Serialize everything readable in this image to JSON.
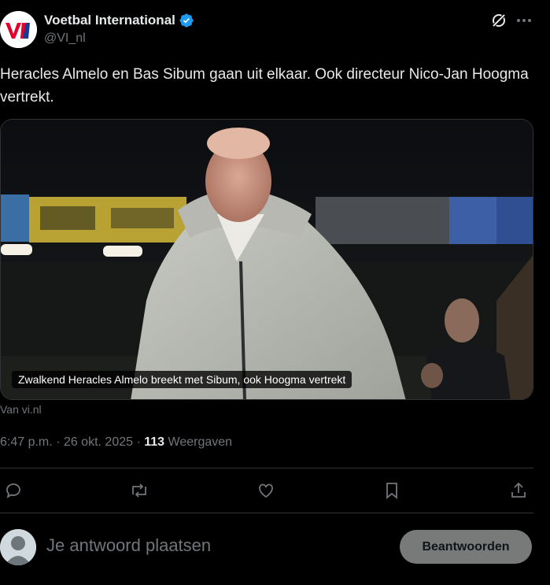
{
  "author": {
    "name": "Voetbal International",
    "handle": "@VI_nl",
    "verified": true,
    "logo_text": "VI",
    "brand_color": "#e4002b"
  },
  "tweet": {
    "text": "Heracles Almelo en Bas Sibum gaan uit elkaar. Ook directeur Nico-Jan Hoogma vertrekt."
  },
  "media": {
    "caption": "Zwalkend Heracles Almelo breekt met Sibum, ook Hoogma vertrekt",
    "source": "Van vi.nl"
  },
  "meta": {
    "time": "6:47 p.m.",
    "separator": "·",
    "date": "26 okt. 2025",
    "separator2": "·",
    "views_count": "113",
    "views_label": "Weergaven"
  },
  "actions": [
    {
      "icon": "reply-icon"
    },
    {
      "icon": "retweet-icon"
    },
    {
      "icon": "like-icon"
    },
    {
      "icon": "bookmark-icon"
    },
    {
      "icon": "share-icon"
    }
  ],
  "reply": {
    "placeholder": "Je antwoord plaatsen",
    "button_label": "Beantwoorden"
  },
  "colors": {
    "background": "#000000",
    "text": "#e7e9ea",
    "muted": "#71767b",
    "verified": "#1d9bf0",
    "divider": "#2f3336"
  }
}
